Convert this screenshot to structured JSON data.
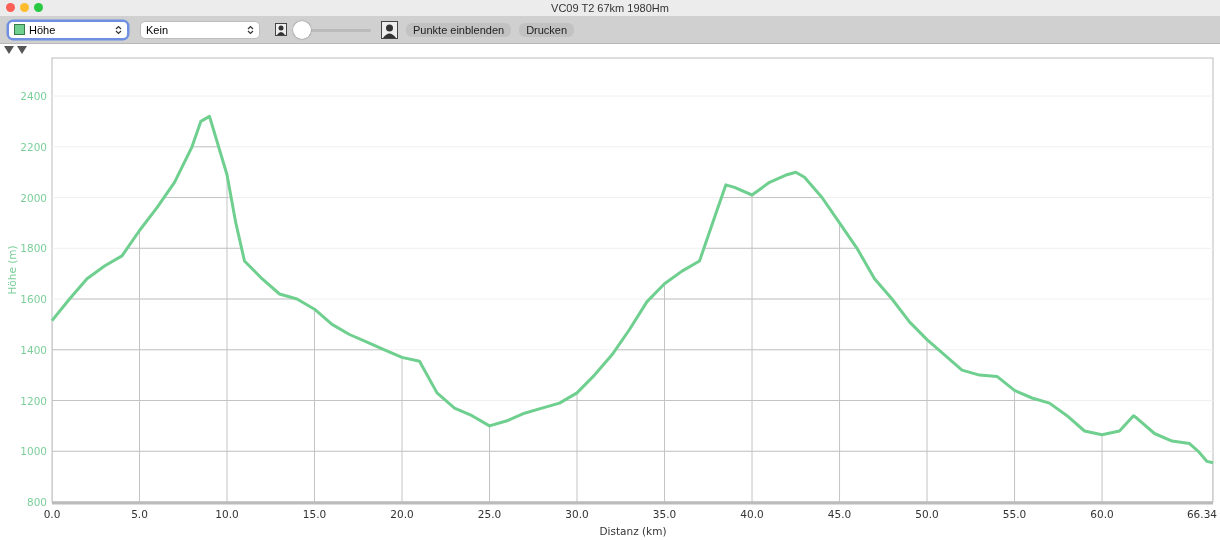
{
  "window": {
    "title": "VC09 T2 67km 1980Hm"
  },
  "toolbar": {
    "profile_select": {
      "value": "Höhe",
      "focused": true
    },
    "overlay_select": {
      "value": "Kein",
      "focused": false
    },
    "zoom_slider": {
      "level": 0.05
    },
    "buttons": [
      "Punkte einblenden",
      "Drucken"
    ]
  },
  "chart": {
    "chart_data": {
      "type": "line",
      "xlabel": "Distanz (km)",
      "ylabel": "Höhe (m)",
      "x": [
        0,
        1,
        2,
        3,
        4,
        5,
        6,
        7,
        8,
        8.5,
        9,
        10,
        10.5,
        11,
        12,
        13,
        14,
        15,
        16,
        17,
        18,
        19,
        20,
        21,
        22,
        23,
        24,
        25,
        26,
        27,
        28,
        29,
        30,
        31,
        32,
        33,
        34,
        35,
        36,
        37,
        38,
        38.5,
        39,
        40,
        41,
        42,
        42.5,
        43,
        44,
        45,
        46,
        47,
        48,
        49,
        50,
        51,
        52,
        53,
        54,
        55,
        56,
        57,
        58,
        59,
        60,
        61,
        61.8,
        62,
        63,
        64,
        65,
        65.5,
        66,
        66.34
      ],
      "series": [
        {
          "color": "#6fcf8f",
          "values": [
            1515,
            1600,
            1680,
            1730,
            1770,
            1870,
            1960,
            2060,
            2200,
            2300,
            2320,
            2090,
            1900,
            1750,
            1680,
            1620,
            1600,
            1560,
            1500,
            1460,
            1430,
            1400,
            1370,
            1355,
            1230,
            1170,
            1140,
            1100,
            1120,
            1150,
            1170,
            1190,
            1230,
            1300,
            1380,
            1480,
            1590,
            1660,
            1710,
            1750,
            1950,
            2050,
            2040,
            2010,
            2060,
            2090,
            2100,
            2080,
            2000,
            1900,
            1800,
            1680,
            1600,
            1510,
            1440,
            1380,
            1320,
            1300,
            1295,
            1240,
            1210,
            1190,
            1140,
            1080,
            1065,
            1080,
            1140,
            1130,
            1070,
            1040,
            1030,
            1000,
            960,
            955
          ]
        }
      ],
      "grid": true,
      "xlim": [
        0,
        66.34
      ],
      "ylim": [
        800,
        2550
      ],
      "xticks": [
        {
          "value": 0,
          "label": "0.0"
        },
        {
          "value": 5,
          "label": "5.0"
        },
        {
          "value": 10,
          "label": "10.0"
        },
        {
          "value": 15,
          "label": "15.0"
        },
        {
          "value": 20,
          "label": "20.0"
        },
        {
          "value": 25,
          "label": "25.0"
        },
        {
          "value": 30,
          "label": "30.0"
        },
        {
          "value": 35,
          "label": "35.0"
        },
        {
          "value": 40,
          "label": "40.0"
        },
        {
          "value": 45,
          "label": "45.0"
        },
        {
          "value": 50,
          "label": "50.0"
        },
        {
          "value": 55,
          "label": "55.0"
        },
        {
          "value": 60,
          "label": "60.0"
        },
        {
          "value": 66.34,
          "label": "66.34"
        }
      ],
      "yticks": [
        800,
        1000,
        1200,
        1400,
        1600,
        1800,
        2000,
        2200,
        2400
      ]
    }
  }
}
